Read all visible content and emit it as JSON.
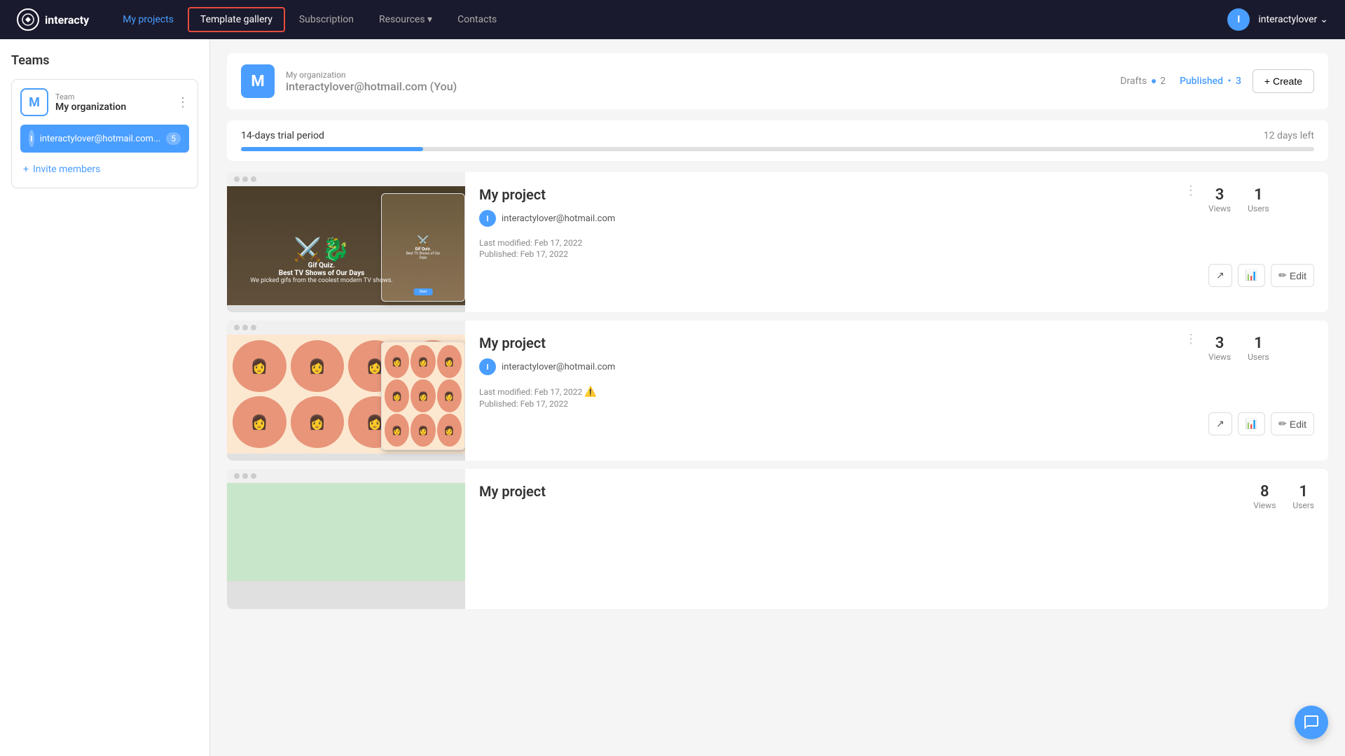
{
  "navbar": {
    "logo_text": "interacty",
    "logo_icon": "✦",
    "links": [
      {
        "label": "My projects",
        "id": "my-projects",
        "active": true,
        "active_box": false
      },
      {
        "label": "Template gallery",
        "id": "template-gallery",
        "active": false,
        "active_box": true
      },
      {
        "label": "Subscription",
        "id": "subscription",
        "active": false,
        "active_box": false
      },
      {
        "label": "Resources ▾",
        "id": "resources",
        "active": false,
        "active_box": false
      },
      {
        "label": "Contacts",
        "id": "contacts",
        "active": false,
        "active_box": false
      }
    ],
    "user_avatar": "I",
    "username": "interactylover",
    "username_arrow": "⌄"
  },
  "sidebar": {
    "title": "Teams",
    "team": {
      "avatar": "M",
      "label": "Team",
      "name": "My organization",
      "menu_icon": "⋮"
    },
    "member": {
      "avatar": "I",
      "email": "interactylover@hotmail.com...",
      "count": 5
    },
    "invite": {
      "icon": "+",
      "label": "Invite members"
    }
  },
  "org_header": {
    "avatar": "M",
    "org_name": "My organization",
    "email": "interactylover@hotmail.com",
    "you_label": "(You)",
    "drafts_label": "Drafts",
    "drafts_count": "2",
    "published_label": "Published",
    "published_count": "3",
    "create_btn": "+ Create"
  },
  "trial": {
    "label": "14-days trial period",
    "days_left": "12 days left",
    "progress_pct": 17
  },
  "projects": [
    {
      "id": "project-1",
      "title": "My project",
      "author_avatar": "I",
      "author_email": "interactylover@hotmail.com",
      "last_modified": "Last modified: Feb 17, 2022",
      "published": "Published: Feb 17, 2022",
      "views": 3,
      "views_label": "Views",
      "users": 1,
      "users_label": "Users",
      "thumb_title": "Gif Quiz.",
      "thumb_subtitle": "Best TV Shows of Our Days",
      "thumb_desc": "We picked gifs from the coolest modern TV shows.",
      "warning": false
    },
    {
      "id": "project-2",
      "title": "My project",
      "author_avatar": "I",
      "author_email": "interactylover@hotmail.com",
      "last_modified": "Last modified: Feb 17, 2022",
      "published": "Published: Feb 17, 2022",
      "views": 3,
      "views_label": "Views",
      "users": 1,
      "users_label": "Users",
      "thumb_title": "",
      "thumb_subtitle": "",
      "thumb_desc": "",
      "warning": true
    },
    {
      "id": "project-3",
      "title": "My project",
      "author_avatar": "I",
      "author_email": "interactylover@hotmail.com",
      "last_modified": "",
      "published": "",
      "views": 8,
      "views_label": "Views",
      "users": 1,
      "users_label": "Users",
      "warning": false
    }
  ],
  "buttons": {
    "external_link": "⬡",
    "stats": "📊",
    "edit": "Edit"
  }
}
